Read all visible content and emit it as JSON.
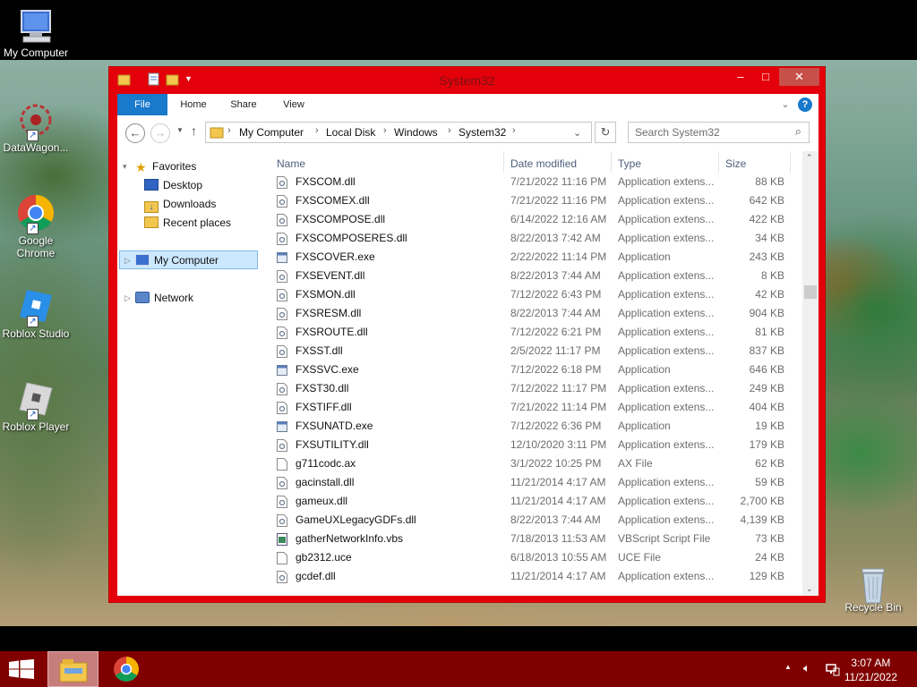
{
  "desktop": {
    "icons": [
      {
        "label": "My Computer"
      },
      {
        "label": "DataWagon..."
      },
      {
        "label": "Google Chrome"
      },
      {
        "label": "Roblox Studio"
      },
      {
        "label": "Roblox Player"
      },
      {
        "label": "Recycle Bin"
      }
    ]
  },
  "window": {
    "title": "System32",
    "controls": {
      "minimize": "–",
      "maximize": "□",
      "close": "✕"
    },
    "ribbon_tabs": [
      "File",
      "Home",
      "Share",
      "View"
    ],
    "help": "?",
    "address": {
      "breadcrumbs": [
        "My Computer",
        "Local Disk",
        "Windows",
        "System32"
      ],
      "separator": "›"
    },
    "search": {
      "placeholder": "Search System32"
    },
    "nav_pane": {
      "favorites": "Favorites",
      "favorites_items": [
        "Desktop",
        "Downloads",
        "Recent places"
      ],
      "my_computer": "My Computer",
      "network": "Network"
    },
    "columns": {
      "name": "Name",
      "date": "Date modified",
      "type": "Type",
      "size": "Size"
    },
    "files": [
      {
        "name": "FXSCOM.dll",
        "date": "7/21/2022 11:16 PM",
        "type": "Application extens...",
        "size": "88 KB",
        "icon": "dll-icon"
      },
      {
        "name": "FXSCOMEX.dll",
        "date": "7/21/2022 11:16 PM",
        "type": "Application extens...",
        "size": "642 KB",
        "icon": "dll-icon"
      },
      {
        "name": "FXSCOMPOSE.dll",
        "date": "6/14/2022 12:16 AM",
        "type": "Application extens...",
        "size": "422 KB",
        "icon": "dll-icon"
      },
      {
        "name": "FXSCOMPOSERES.dll",
        "date": "8/22/2013 7:42 AM",
        "type": "Application extens...",
        "size": "34 KB",
        "icon": "dll-icon"
      },
      {
        "name": "FXSCOVER.exe",
        "date": "2/22/2022 11:14 PM",
        "type": "Application",
        "size": "243 KB",
        "icon": "exe-icon"
      },
      {
        "name": "FXSEVENT.dll",
        "date": "8/22/2013 7:44 AM",
        "type": "Application extens...",
        "size": "8 KB",
        "icon": "dll-icon"
      },
      {
        "name": "FXSMON.dll",
        "date": "7/12/2022 6:43 PM",
        "type": "Application extens...",
        "size": "42 KB",
        "icon": "dll-icon"
      },
      {
        "name": "FXSRESM.dll",
        "date": "8/22/2013 7:44 AM",
        "type": "Application extens...",
        "size": "904 KB",
        "icon": "dll-icon"
      },
      {
        "name": "FXSROUTE.dll",
        "date": "7/12/2022 6:21 PM",
        "type": "Application extens...",
        "size": "81 KB",
        "icon": "dll-icon"
      },
      {
        "name": "FXSST.dll",
        "date": "2/5/2022 11:17 PM",
        "type": "Application extens...",
        "size": "837 KB",
        "icon": "dll-icon"
      },
      {
        "name": "FXSSVC.exe",
        "date": "7/12/2022 6:18 PM",
        "type": "Application",
        "size": "646 KB",
        "icon": "exe-icon"
      },
      {
        "name": "FXST30.dll",
        "date": "7/12/2022 11:17 PM",
        "type": "Application extens...",
        "size": "249 KB",
        "icon": "dll-icon"
      },
      {
        "name": "FXSTIFF.dll",
        "date": "7/21/2022 11:14 PM",
        "type": "Application extens...",
        "size": "404 KB",
        "icon": "dll-icon"
      },
      {
        "name": "FXSUNATD.exe",
        "date": "7/12/2022 6:36 PM",
        "type": "Application",
        "size": "19 KB",
        "icon": "exe-icon"
      },
      {
        "name": "FXSUTILITY.dll",
        "date": "12/10/2020 3:11 PM",
        "type": "Application extens...",
        "size": "179 KB",
        "icon": "dll-icon"
      },
      {
        "name": "g711codc.ax",
        "date": "3/1/2022 10:25 PM",
        "type": "AX File",
        "size": "62 KB",
        "icon": "file-icon"
      },
      {
        "name": "gacinstall.dll",
        "date": "11/21/2014 4:17 AM",
        "type": "Application extens...",
        "size": "59 KB",
        "icon": "dll-icon"
      },
      {
        "name": "gameux.dll",
        "date": "11/21/2014 4:17 AM",
        "type": "Application extens...",
        "size": "2,700 KB",
        "icon": "dll-icon"
      },
      {
        "name": "GameUXLegacyGDFs.dll",
        "date": "8/22/2013 7:44 AM",
        "type": "Application extens...",
        "size": "4,139 KB",
        "icon": "dll-icon"
      },
      {
        "name": "gatherNetworkInfo.vbs",
        "date": "7/18/2013 11:53 AM",
        "type": "VBScript Script File",
        "size": "73 KB",
        "icon": "vbs-icon"
      },
      {
        "name": "gb2312.uce",
        "date": "6/18/2013 10:55 AM",
        "type": "UCE File",
        "size": "24 KB",
        "icon": "file-icon"
      },
      {
        "name": "gcdef.dll",
        "date": "11/21/2014 4:17 AM",
        "type": "Application extens...",
        "size": "129 KB",
        "icon": "dll-icon"
      }
    ]
  },
  "taskbar": {
    "time": "3:07 AM",
    "date": "11/21/2022",
    "tray_arrow": "▲"
  },
  "colors": {
    "window_frame": "#e3000b",
    "taskbar": "#800000",
    "file_tab": "#1979ca",
    "selection": "#cce8ff"
  }
}
